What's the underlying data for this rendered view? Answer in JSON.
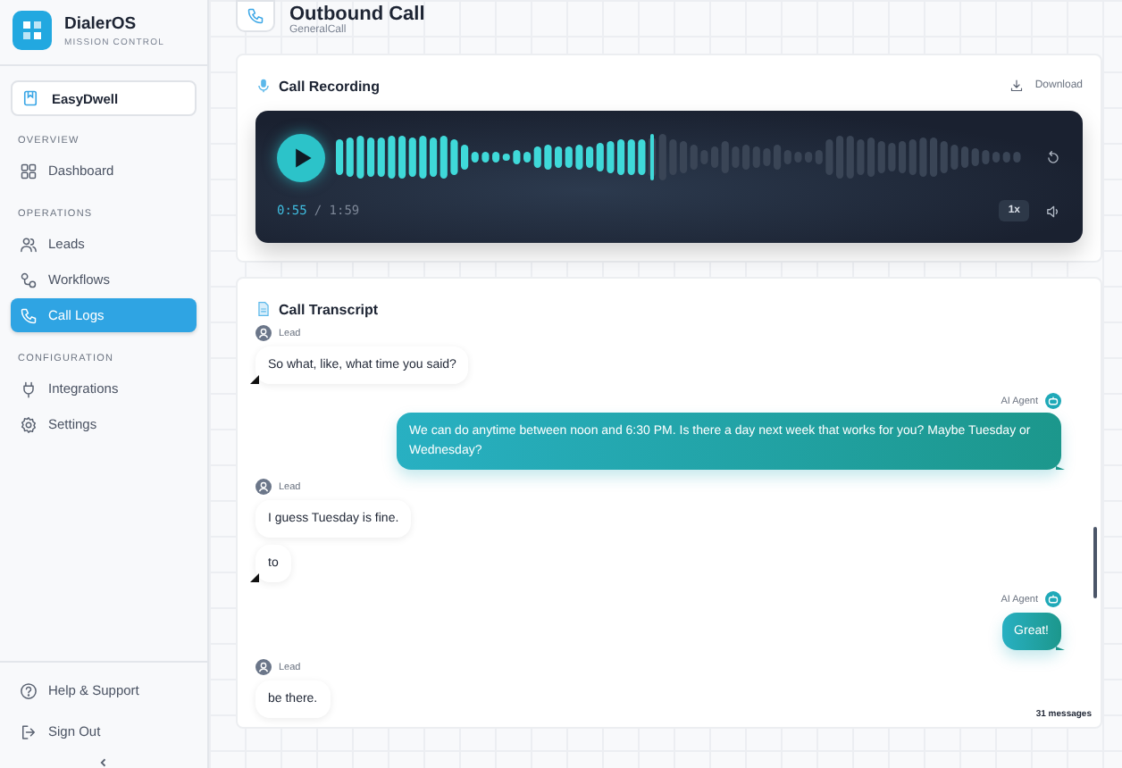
{
  "brand": {
    "name": "DialerOS",
    "tagline": "MISSION CONTROL"
  },
  "workspace": {
    "name": "EasyDwell"
  },
  "sidebar": {
    "sections": [
      {
        "label": "OVERVIEW",
        "items": [
          {
            "label": "Dashboard",
            "selected": false
          }
        ]
      },
      {
        "label": "OPERATIONS",
        "items": [
          {
            "label": "Leads",
            "selected": false
          },
          {
            "label": "Workflows",
            "selected": false
          },
          {
            "label": "Call Logs",
            "selected": true
          }
        ]
      },
      {
        "label": "CONFIGURATION",
        "items": [
          {
            "label": "Integrations",
            "selected": false
          },
          {
            "label": "Settings",
            "selected": false
          }
        ]
      }
    ],
    "footer": [
      {
        "label": "Help & Support"
      },
      {
        "label": "Sign Out"
      }
    ]
  },
  "header": {
    "title": "Outbound Call",
    "subtitle": "GeneralCall"
  },
  "recording": {
    "title": "Call Recording",
    "download": "Download",
    "level": 0.46,
    "elapsed": "0:55",
    "total": "/ 1:59",
    "speed": "1x"
  },
  "transcript": {
    "title": "Call Transcript",
    "count": "31 messages",
    "messages": [
      {
        "kind": "lead",
        "sender": "Lead",
        "text": "So what, like, what time you said?",
        "tail": true
      },
      {
        "kind": "agent",
        "sender": "AI Agent",
        "text": "We can do anytime between noon and 6:30 PM. Is there a day next week that works for you? Maybe Tuesday or Wednesday?",
        "tail": true
      },
      {
        "kind": "lead",
        "sender": "Lead",
        "text": "I guess Tuesday is fine.",
        "tail": false
      },
      {
        "kind": "lead",
        "text": "to",
        "tail": true
      },
      {
        "kind": "agent",
        "sender": "AI Agent",
        "text": "Great!",
        "tail": true
      },
      {
        "kind": "lead",
        "sender": "Lead",
        "text": "be there.",
        "tail": false
      }
    ]
  }
}
